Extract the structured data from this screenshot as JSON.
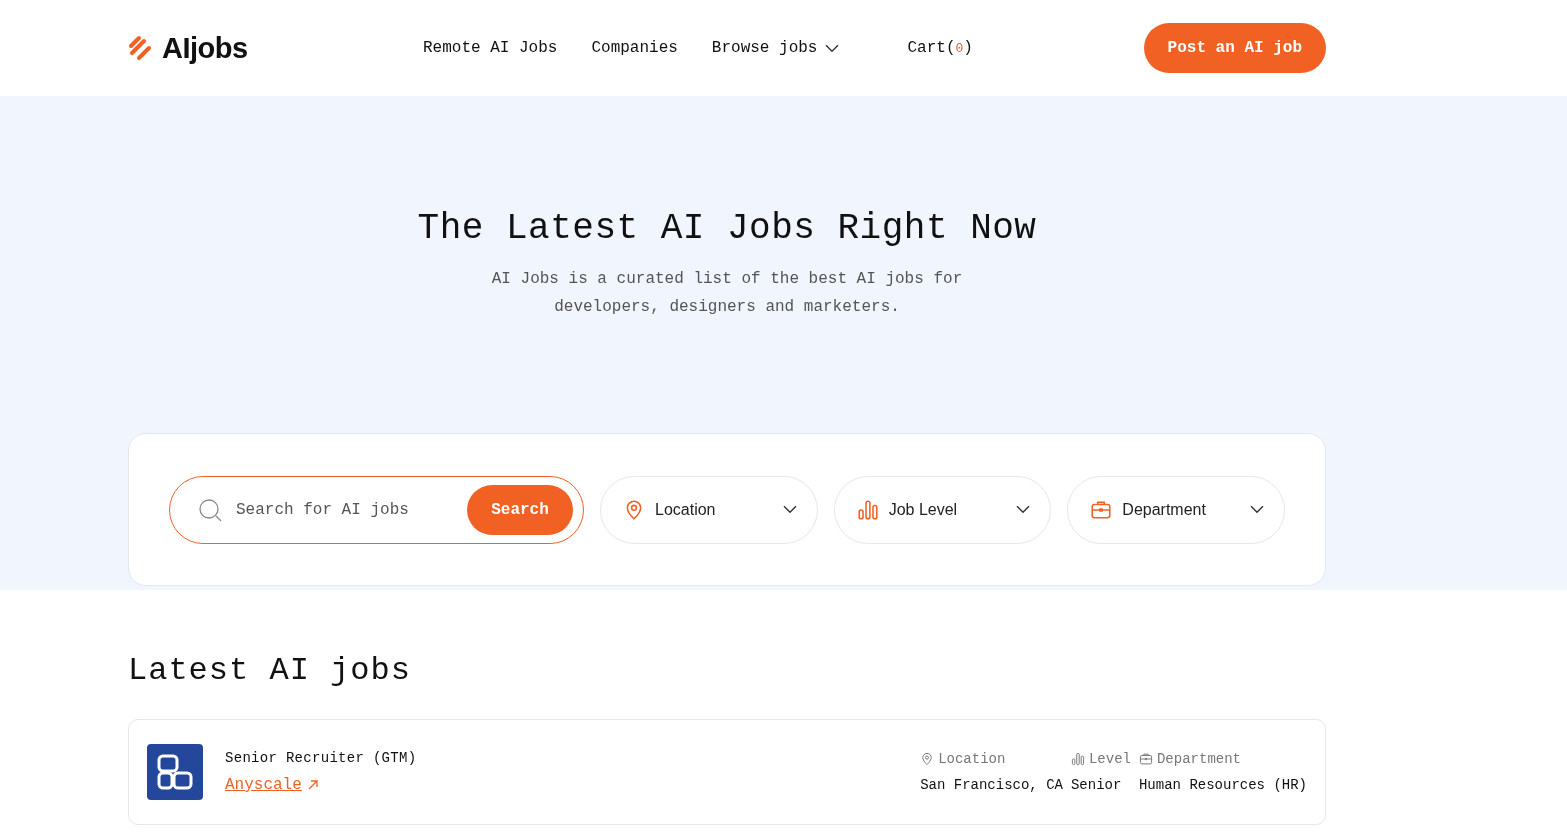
{
  "logo": {
    "text": "AIjobs"
  },
  "nav": [
    {
      "label": "Remote AI Jobs",
      "dropdown": false
    },
    {
      "label": "Companies",
      "dropdown": false
    },
    {
      "label": "Browse jobs",
      "dropdown": true
    }
  ],
  "cart": {
    "label": "Cart(",
    "count": "0",
    "close": ")"
  },
  "post_button": "Post an AI job",
  "hero": {
    "title": "The Latest AI Jobs Right Now",
    "subtitle": "AI Jobs is a curated list of the best AI jobs for developers, designers and marketers."
  },
  "search": {
    "placeholder": "Search for AI jobs",
    "button": "Search"
  },
  "filters": [
    {
      "kind": "location",
      "label": "Location"
    },
    {
      "kind": "level",
      "label": "Job Level"
    },
    {
      "kind": "department",
      "label": "Department"
    }
  ],
  "section_title": "Latest AI jobs",
  "jobs": [
    {
      "title": "Senior Recruiter (GTM)",
      "company": "Anyscale",
      "meta": [
        {
          "kind": "location",
          "label": "Location",
          "value": "San Francisco, CA"
        },
        {
          "kind": "level",
          "label": "Level",
          "value": "Senior"
        },
        {
          "kind": "department",
          "label": "Department",
          "value": "Human Resources (HR)"
        }
      ]
    }
  ]
}
